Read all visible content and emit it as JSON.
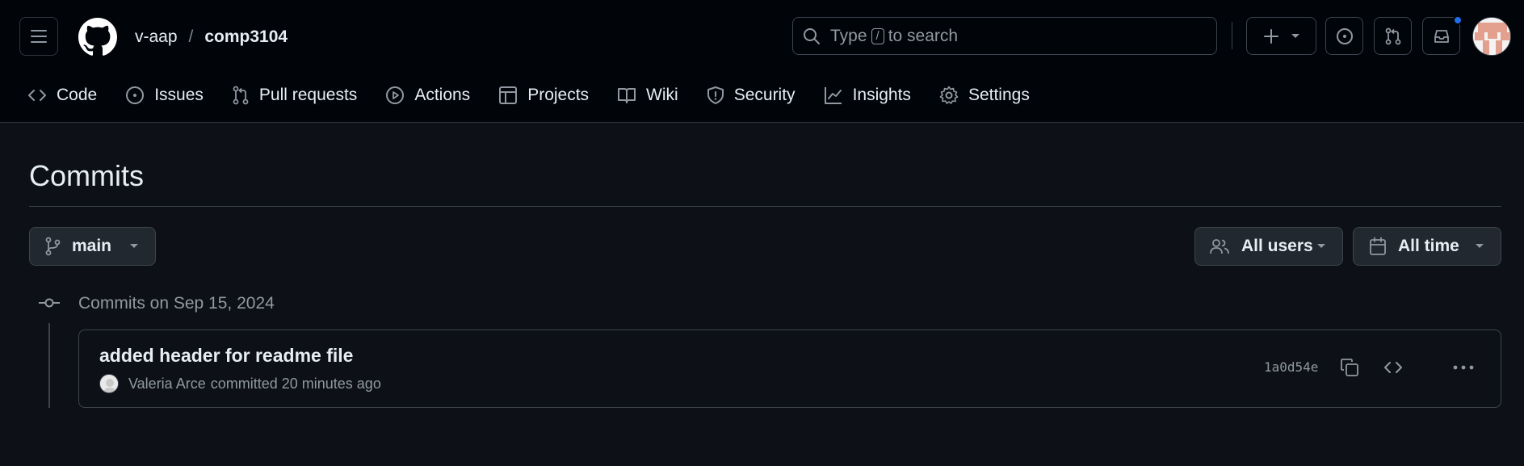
{
  "header": {
    "owner": "v-aap",
    "separator": "/",
    "repo": "comp3104",
    "search": {
      "before": "Type",
      "key": "/",
      "after": "to search"
    }
  },
  "tabs": [
    {
      "label": "Code",
      "icon": "code-icon"
    },
    {
      "label": "Issues",
      "icon": "issue-icon"
    },
    {
      "label": "Pull requests",
      "icon": "pull-request-icon"
    },
    {
      "label": "Actions",
      "icon": "play-icon"
    },
    {
      "label": "Projects",
      "icon": "table-icon"
    },
    {
      "label": "Wiki",
      "icon": "book-icon"
    },
    {
      "label": "Security",
      "icon": "shield-icon"
    },
    {
      "label": "Insights",
      "icon": "graph-icon"
    },
    {
      "label": "Settings",
      "icon": "gear-icon"
    }
  ],
  "page": {
    "title": "Commits",
    "branch": "main",
    "users_filter": "All users",
    "time_filter": "All time"
  },
  "commit_groups": [
    {
      "label": "Commits on Sep 15, 2024",
      "commits": [
        {
          "message": "added header for readme file",
          "author": "Valeria Arce",
          "action": "committed 20 minutes ago",
          "sha": "1a0d54e"
        }
      ]
    }
  ],
  "colors": {
    "background": "#0d1117",
    "header_bg": "#010409",
    "border": "#3d444d",
    "text": "#e6edf3",
    "muted": "#9198a1",
    "accent": "#1f6feb"
  }
}
